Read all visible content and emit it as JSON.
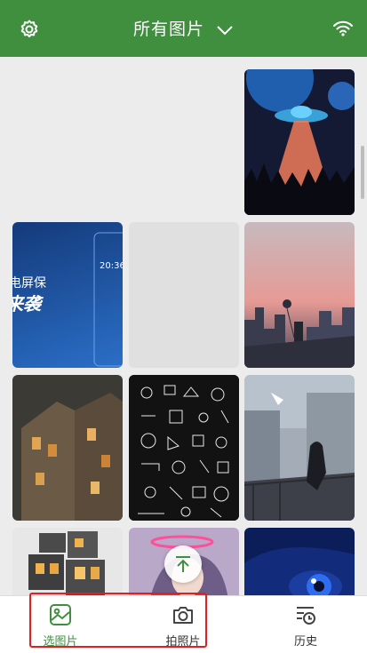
{
  "header": {
    "title": "所有图片",
    "settings_icon": "gear-icon",
    "dropdown_icon": "chevron-down-icon",
    "wifi_icon": "wifi-icon"
  },
  "gallery": {
    "promo_tile": {
      "time": "20:36",
      "line1": "电屏保",
      "line2": "来袭"
    }
  },
  "bottom_nav": {
    "items": [
      {
        "label": "选图片",
        "icon": "image-select-icon",
        "active": true
      },
      {
        "label": "拍照片",
        "icon": "camera-icon",
        "active": false
      },
      {
        "label": "历史",
        "icon": "history-icon",
        "active": false
      }
    ]
  },
  "colors": {
    "accent": "#3f8f3f",
    "highlight": "#e02020"
  }
}
